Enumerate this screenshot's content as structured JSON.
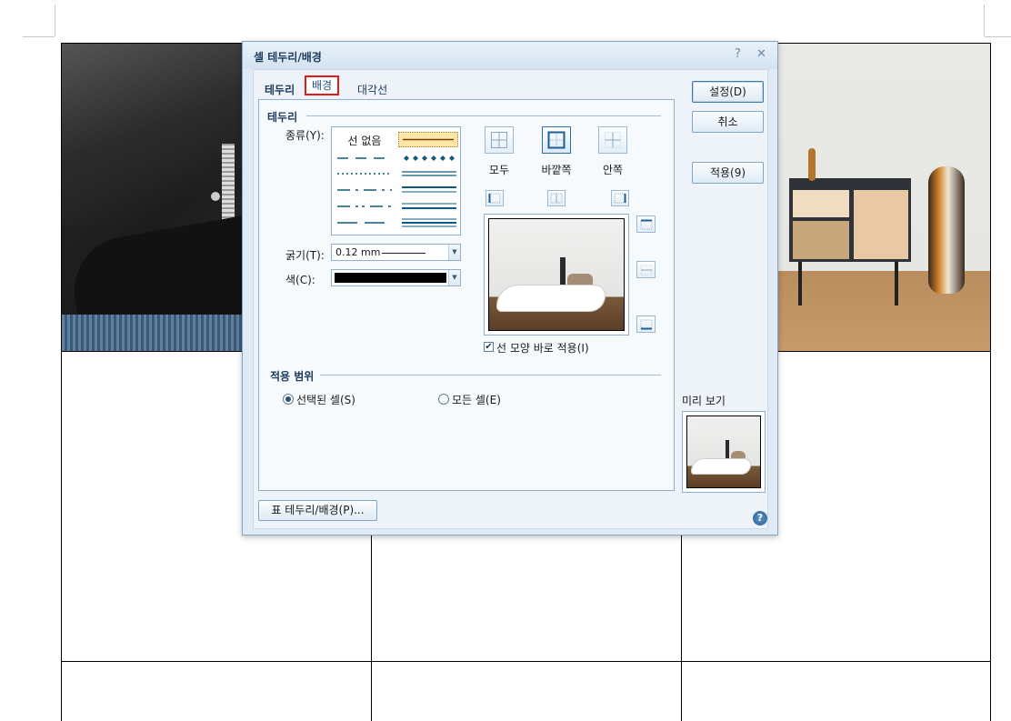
{
  "dialog": {
    "title": "셀 테두리/배경",
    "help_glyph": "?",
    "close_glyph": "✕",
    "tabs": [
      "테두리",
      "배경",
      "대각선"
    ],
    "border_group": "테두리",
    "type_label": "종류(Y):",
    "no_line": "선 없음",
    "thickness_label": "굵기(T):",
    "thickness_value": "0.12 mm",
    "color_label": "색(C):",
    "color_value": "#000000",
    "presets": [
      "모두",
      "바깥쪽",
      "안쪽"
    ],
    "apply_line_check": "선 모양 바로 적용(I)",
    "apply_line_checked": true,
    "range_group": "적용 범위",
    "range_options": [
      "선택된 셀(S)",
      "모든 셀(E)"
    ],
    "range_selected": 0,
    "buttons": {
      "ok": "설정(D)",
      "cancel": "취소",
      "apply": "적용(9)",
      "table_border": "표 테두리/배경(P)..."
    },
    "preview_label": "미리 보기",
    "help_icon": "?"
  }
}
